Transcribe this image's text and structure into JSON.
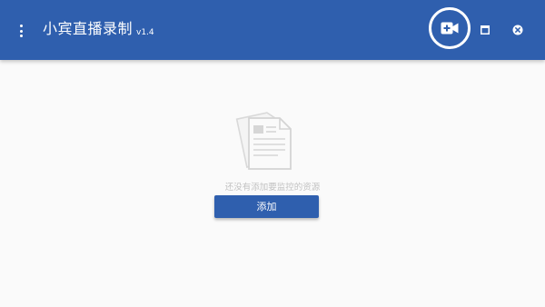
{
  "app": {
    "title": "小宾直播录制",
    "version": "v1.4"
  },
  "titlebar": {
    "menu_icon": "more-vertical-icon",
    "record_icon": "video-camera-add-icon",
    "maximize_icon": "maximize-icon",
    "close_icon": "close-circle-icon"
  },
  "empty_state": {
    "icon": "document-stack-icon",
    "message": "还没有添加要监控的资源",
    "add_label": "添加"
  },
  "colors": {
    "accent": "#2f5fae",
    "background": "#fafafa",
    "muted_text": "#c2c2c2",
    "icon_gray": "#d6d6d6"
  }
}
